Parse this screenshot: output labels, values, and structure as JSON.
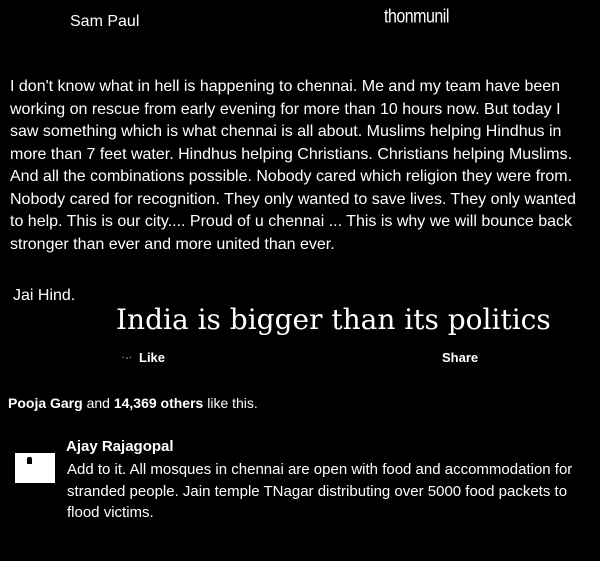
{
  "post": {
    "author": "Sam Paul",
    "stamp_text": "thonmunil",
    "body": "I don't know what in hell is happening to chennai. Me and my team have been working on rescue from early evening for more than 10 hours now. But today I saw something which is what chennai is all about. Muslims helping Hindhus in more than 7 feet water. Hindhus helping Christians. Christians helping Muslims. And all the combinations possible. Nobody cared which religion they were from. Nobody cared for recognition. They only wanted to save lives. They only wanted to help. This is our city.... Proud of u chennai ... This is why we will bounce back stronger than ever and more united than ever.",
    "signoff": "Jai Hind."
  },
  "overlay_caption": "India is bigger than its politics",
  "actions": {
    "like_label": "Like",
    "share_label": "Share"
  },
  "likes": {
    "first_liker": "Pooja Garg",
    "connector": " and ",
    "others": "14,369 others",
    "suffix": " like this."
  },
  "comment": {
    "author": "Ajay Rajagopal",
    "text": "Add to it. All mosques in chennai are open with food and accommodation for stranded people. Jain temple TNagar distributing over 5000 food packets to flood victims."
  },
  "icons": {
    "like": "like-icon",
    "avatar": "avatar-icon"
  }
}
